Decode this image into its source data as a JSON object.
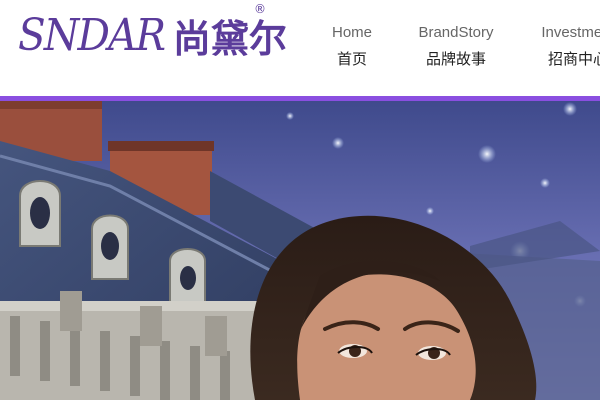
{
  "brand": {
    "latin": "SNDAR",
    "chinese": "尚黛尔",
    "registered": "®"
  },
  "nav": {
    "items": [
      {
        "en": "Home",
        "cn": "首页"
      },
      {
        "en": "BrandStory",
        "cn": "品牌故事"
      },
      {
        "en": "Investment",
        "cn": "招商中心"
      }
    ]
  },
  "colors": {
    "brand": "#5b3c9b",
    "accent_bar": "#8a4fe0",
    "sky": "#5a63a8"
  },
  "banner": {
    "subject": "model-portrait",
    "background": "chateau-night-sky"
  }
}
